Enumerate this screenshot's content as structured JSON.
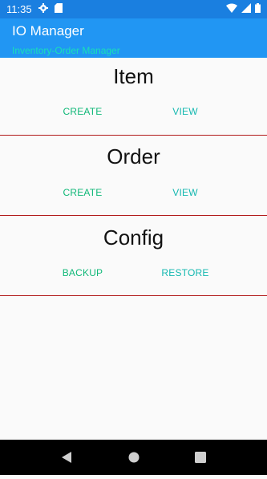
{
  "status_bar": {
    "time": "11:35",
    "icons": [
      "gear-icon",
      "sd-card-icon",
      "wifi-icon",
      "signal-icon",
      "battery-icon"
    ]
  },
  "app_bar": {
    "title": "IO Manager",
    "subtitle": "Inventory-Order Manager",
    "background": "#2196f3",
    "subtitle_color": "#18e0b8"
  },
  "sections": {
    "item": {
      "title": "Item",
      "left_button": "CREATE",
      "right_button": "VIEW"
    },
    "order": {
      "title": "Order",
      "left_button": "CREATE",
      "right_button": "VIEW"
    },
    "config": {
      "title": "Config",
      "left_button": "BACKUP",
      "right_button": "RESTORE"
    }
  },
  "nav_bar": {
    "icons": [
      "back-icon",
      "home-icon",
      "recents-icon"
    ]
  }
}
